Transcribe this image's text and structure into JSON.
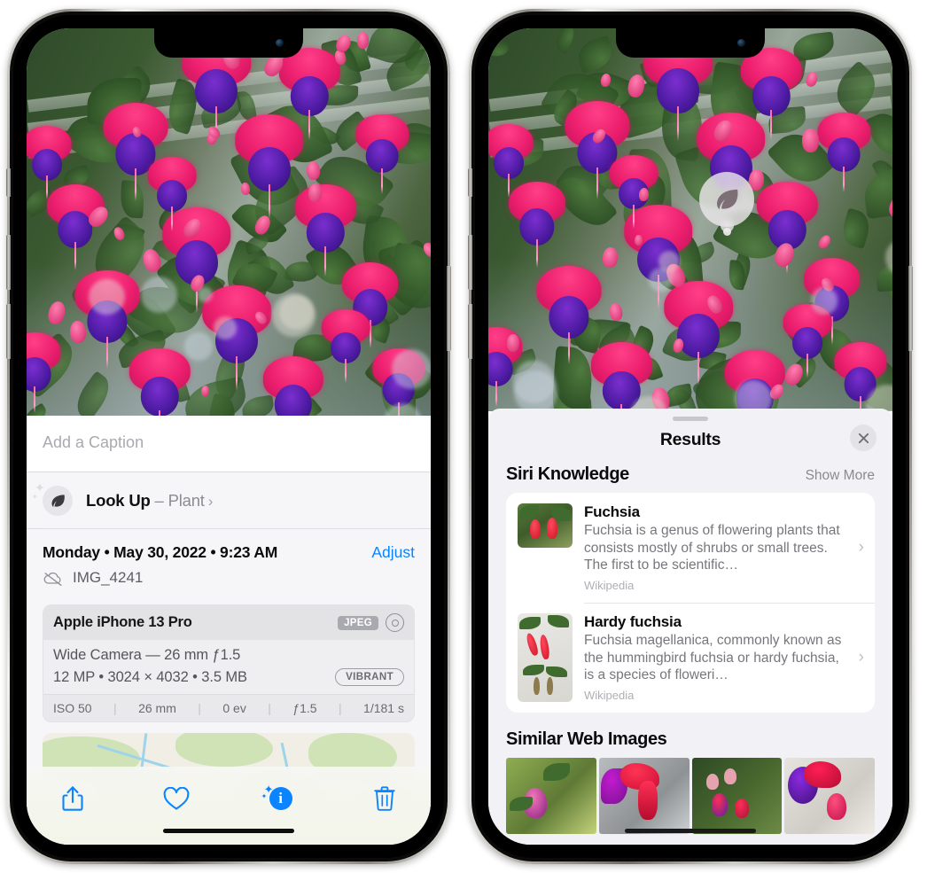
{
  "meta": {
    "accent_blue": "#0a84ff",
    "sheet_bg": "#f2f1f6",
    "info_bg": "#f6f6f8"
  },
  "left_phone": {
    "name": "photos-detail-phone",
    "caption": {
      "placeholder": "Add a Caption",
      "value": ""
    },
    "lookup": {
      "icon": "leaf-icon",
      "label": "Look Up",
      "dash": " – ",
      "subject": "Plant",
      "chevron": "›"
    },
    "photo_meta": {
      "date": "Monday • May 30, 2022 • 9:23 AM",
      "adjust_label": "Adjust",
      "filename": "IMG_4241",
      "cloud_icon": "cloud-slash-icon"
    },
    "exif": {
      "device": "Apple iPhone 13 Pro",
      "format_badge": "JPEG",
      "raw_icon": "raw-circle-icon",
      "lens": "Wide Camera — 26 mm ƒ1.5",
      "size": "12 MP • 3024 × 4032 • 3.5 MB",
      "style_badge": "VIBRANT",
      "stats": [
        "ISO 50",
        "26 mm",
        "0 ev",
        "ƒ1.5",
        "1/181 s"
      ]
    },
    "map": {
      "label": "photo-location-map"
    },
    "toolbar": {
      "share": "share-icon",
      "favorite": "heart-icon",
      "info": "info-sparkle-icon",
      "delete": "trash-icon"
    }
  },
  "right_phone": {
    "name": "visual-lookup-phone",
    "badge": {
      "icon": "leaf-icon"
    },
    "sheet": {
      "title": "Results",
      "close": "close-icon",
      "grabber": "drag-handle"
    },
    "siri_knowledge": {
      "title": "Siri Knowledge",
      "action": "Show More",
      "results": [
        {
          "title": "Fuchsia",
          "description": "Fuchsia is a genus of flowering plants that consists mostly of shrubs or small trees. The first to be scientific…",
          "source": "Wikipedia",
          "chevron": "›"
        },
        {
          "title": "Hardy fuchsia",
          "description": "Fuchsia magellanica, commonly known as the hummingbird fuchsia or hardy fuchsia, is a species of floweri…",
          "source": "Wikipedia",
          "chevron": "›"
        }
      ]
    },
    "similar_web_images": {
      "title": "Similar Web Images",
      "thumbs": [
        "web-image-1",
        "web-image-2",
        "web-image-3",
        "web-image-4"
      ]
    }
  }
}
